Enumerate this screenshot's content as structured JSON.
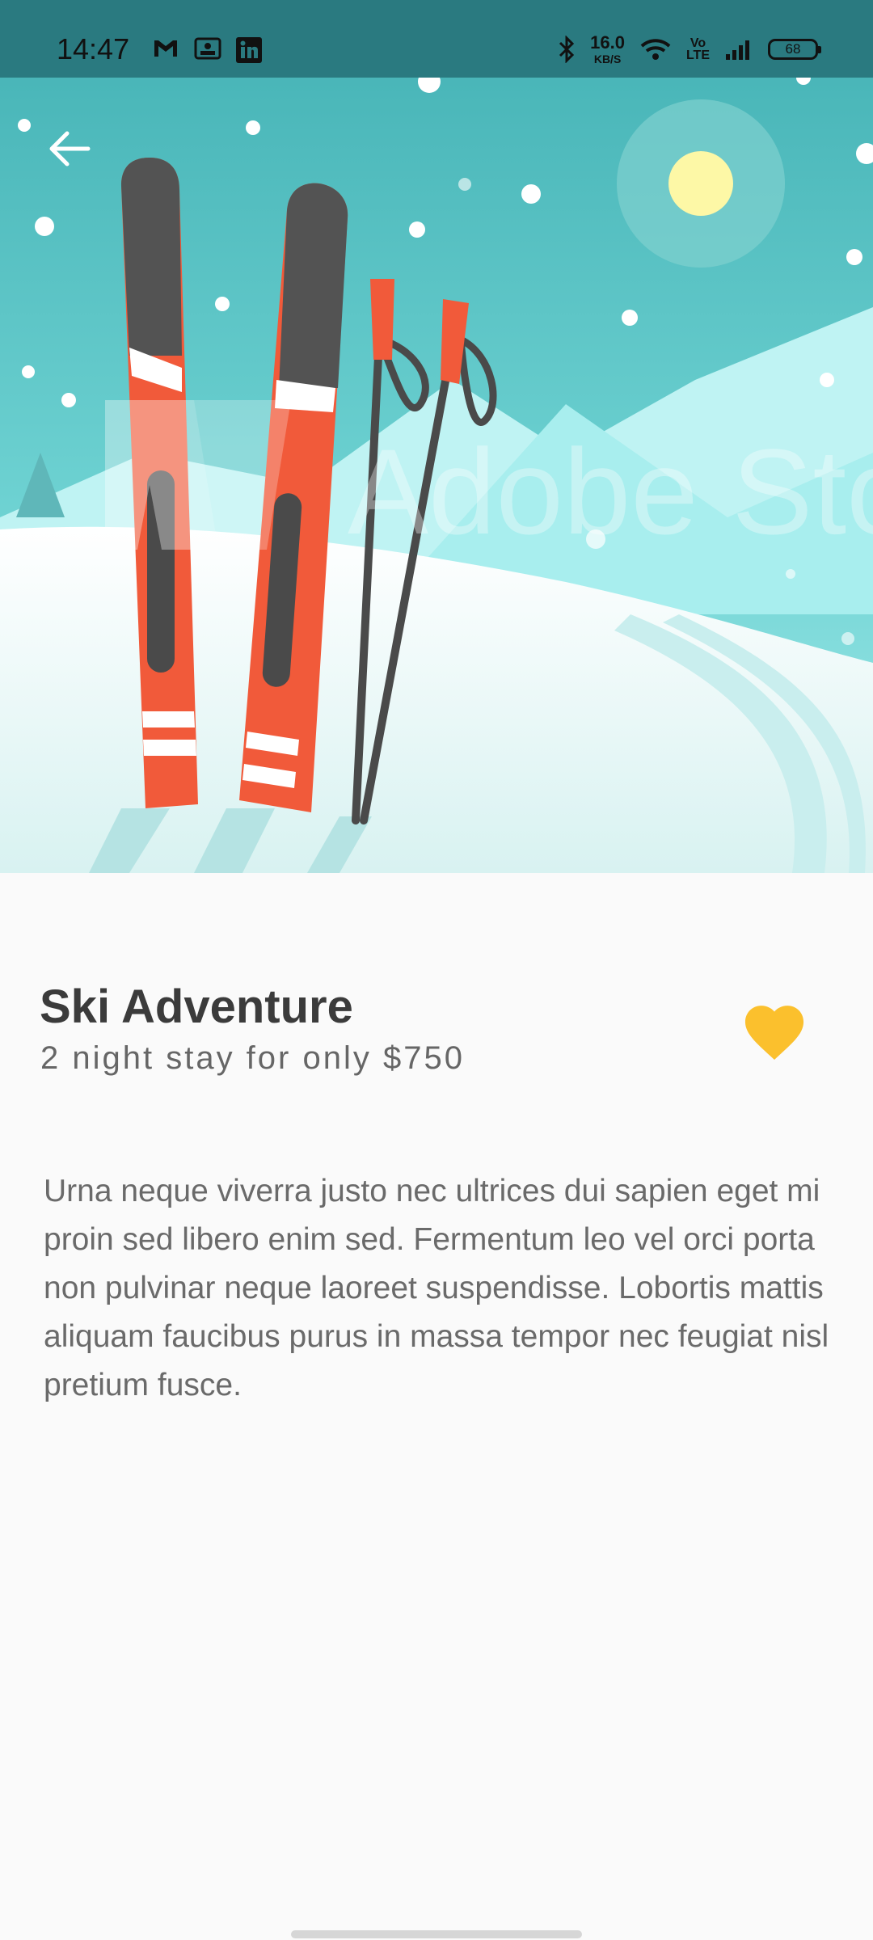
{
  "status_bar": {
    "time": "14:47",
    "notification_icons": [
      "gmail-icon",
      "photos-icon",
      "linkedin-icon"
    ],
    "net_speed": "16.0",
    "net_speed_unit": "KB/S",
    "volte_line1": "Vo",
    "volte_line2": "LTE",
    "battery": "68"
  },
  "hero": {
    "watermark": "Adobe Sto"
  },
  "content": {
    "title": "Ski Adventure",
    "subtitle": "2 night stay for only $750",
    "description": "Urna neque viverra justo nec ultrices dui sapien eget mi proin sed libero enim sed. Fermentum leo vel orci porta non pulvinar neque laoreet suspendisse. Lobortis mattis aliquam faucibus purus in massa tempor nec feugiat nisl pretium fusce."
  },
  "colors": {
    "favorite": "#fbc02d",
    "status_bar": "#2a7a80",
    "sky": "#4ab8bb",
    "ski": "#f15a3a",
    "background": "#fafafa"
  }
}
